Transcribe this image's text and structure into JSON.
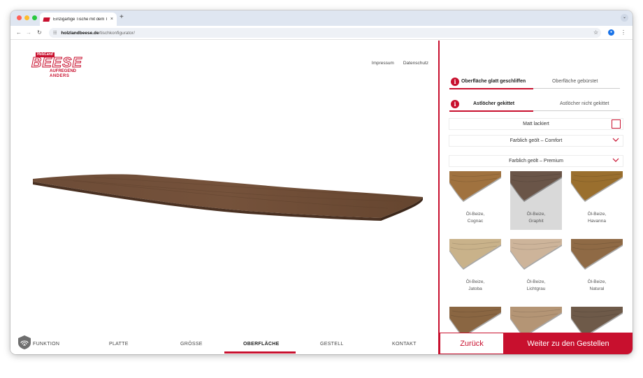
{
  "browser": {
    "tab_title": "Einzigartige Tische mit dem T",
    "tab_close": "×",
    "new_tab": "+",
    "tabs_dropdown": "⌄",
    "url_domain": "holzlandbeese.de",
    "url_path": "/tischkonfigurator/",
    "icons": [
      "back-arrow-icon",
      "forward-arrow-icon",
      "reload-icon",
      "site-info-icon",
      "bookmark-star-icon",
      "profile-icon",
      "more-menu-icon"
    ]
  },
  "logo": {
    "holzland": "HolzLand",
    "beese": "BEESE",
    "aufregend": "AUFREGEND",
    "anders": "ANDERS"
  },
  "header_links": [
    "Impressum",
    "Datenschutz"
  ],
  "bottom_nav": {
    "items": [
      "FUNKTION",
      "PLATTE",
      "GRÖSSE",
      "OBERFLÄCHE",
      "GESTELL",
      "KONTAKT"
    ],
    "active": "OBERFLÄCHE"
  },
  "config": {
    "row1": {
      "active": "Oberfläche glatt geschliffen",
      "inactive": "Oberfläche gebürstet"
    },
    "row2": {
      "active": "Astlöcher gekittet",
      "inactive": "Astlöcher nicht gekittet"
    },
    "info_glyph": "i",
    "matt": "Matt lackiert",
    "comfort": "Farblich geölt – Comfort",
    "premium": "Farblich geölt – Premium",
    "swatches": [
      {
        "line1": "Öl-Beize,",
        "line2": "Cognac",
        "color": "#a0723f",
        "selected": false
      },
      {
        "line1": "Öl-Beize,",
        "line2": "Graphit",
        "color": "#6a5548",
        "selected": true
      },
      {
        "line1": "Öl-Beize,",
        "line2": "Havanna",
        "color": "#9a6f2e",
        "selected": false
      },
      {
        "line1": "Öl-Beize,",
        "line2": "Jatoba",
        "color": "#c9b28a",
        "selected": false
      },
      {
        "line1": "Öl-Beize,",
        "line2": "Lichtgrau",
        "color": "#cdb49a",
        "selected": false
      },
      {
        "line1": "Öl-Beize,",
        "line2": "Natural",
        "color": "#8f6a45",
        "selected": false
      },
      {
        "line1": "",
        "line2": "",
        "color": "#8a6642",
        "selected": false
      },
      {
        "line1": "",
        "line2": "",
        "color": "#b49575",
        "selected": false
      },
      {
        "line1": "",
        "line2": "",
        "color": "#6e5a49",
        "selected": false
      }
    ],
    "back_label": "Zurück",
    "next_label": "Weiter zu den Gestellen"
  },
  "colors": {
    "accent": "#c8102e",
    "tabletop": "#6a4a36"
  }
}
